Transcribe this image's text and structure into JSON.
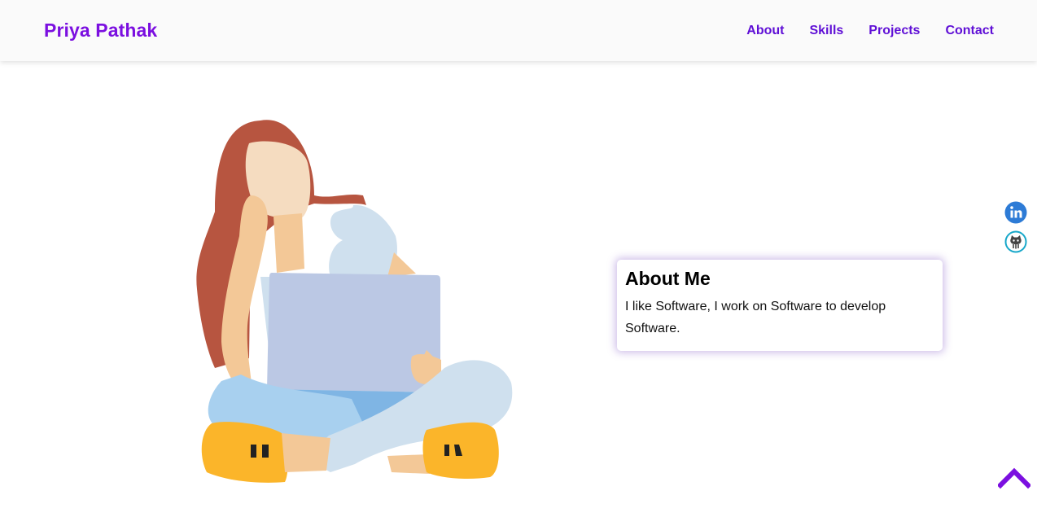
{
  "header": {
    "brand": "Priya Pathak",
    "nav": [
      {
        "label": "About"
      },
      {
        "label": "Skills"
      },
      {
        "label": "Projects"
      },
      {
        "label": "Contact"
      }
    ]
  },
  "about": {
    "title": "About Me",
    "text": "I like Software, I work on Software to develop Software."
  },
  "social": [
    {
      "icon": "linkedin-icon",
      "color": "#2d7bd6"
    },
    {
      "icon": "github-icon",
      "color": "#17a7c9"
    }
  ],
  "scroll_top": {
    "icon": "chevron-up-icon",
    "color": "#7b0fe0"
  },
  "colors": {
    "accent": "#7b0fe0",
    "nav_link": "#5f0fd6",
    "navbar_bg": "#fafafa"
  }
}
